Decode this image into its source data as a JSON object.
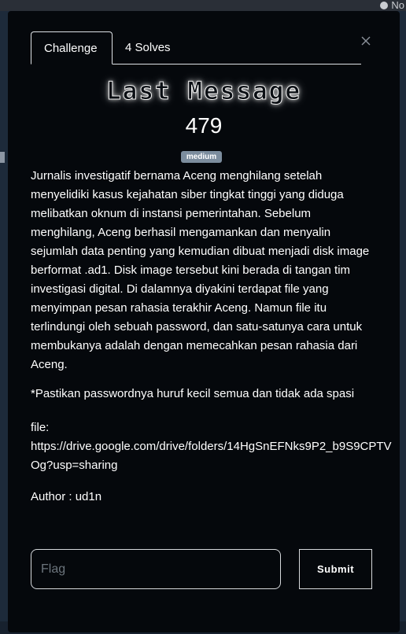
{
  "background": {
    "user_label": "No"
  },
  "tabs": [
    {
      "label": "Challenge"
    },
    {
      "label": "4 Solves"
    }
  ],
  "challenge": {
    "title": "Last Message",
    "points": "479",
    "difficulty": "medium",
    "description": "Jurnalis investigatif bernama Aceng menghilang setelah menyelidiki kasus kejahatan siber tingkat tinggi yang diduga melibatkan oknum di instansi pemerintahan. Sebelum menghilang, Aceng berhasil mengamankan dan menyalin sejumlah data penting yang kemudian dibuat menjadi disk image berformat .ad1. Disk image tersebut kini berada di tangan tim investigasi digital. Di dalamnya diyakini terdapat file yang menyimpan pesan rahasia terakhir Aceng. Namun file itu terlindungi oleh sebuah password, dan satu-satunya cara untuk membukanya adalah dengan memecahkan pesan rahasia dari Aceng.",
    "note": "*Pastikan passwordnya huruf kecil semua dan tidak ada spasi",
    "file_label": "file:",
    "file_url_line1": "https://drive.google.com/drive/folders/14HgSnEFNks9P2_b9S9CPTV",
    "file_url_line2": "Og?usp=sharing",
    "author": "Author : ud1n"
  },
  "form": {
    "flag_placeholder": "Flag",
    "submit_label": "Submit"
  },
  "colors": {
    "modal_bg": "#05080c",
    "badge_bg": "#7c8d9e",
    "border": "#dee2e6"
  },
  "icons": {
    "close": "close-icon",
    "user": "user-icon"
  }
}
